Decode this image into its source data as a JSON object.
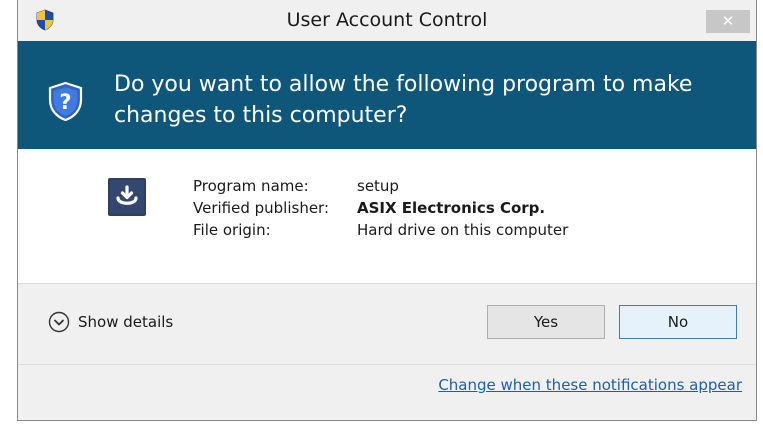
{
  "window": {
    "title": "User Account Control",
    "close_glyph": "✕"
  },
  "header": {
    "question": "Do you want to allow the following program to make changes to this computer?",
    "icon": "help-shield-icon"
  },
  "program": {
    "icon": "setup-icon",
    "fields": [
      {
        "label": "Program name:",
        "value": "setup",
        "bold": false
      },
      {
        "label": "Verified publisher:",
        "value": "ASIX Electronics Corp.",
        "bold": true
      },
      {
        "label": "File origin:",
        "value": "Hard drive on this computer",
        "bold": false
      }
    ]
  },
  "actions": {
    "show_details": "Show details",
    "yes": "Yes",
    "no": "No"
  },
  "footer": {
    "link": "Change when these notifications appear"
  },
  "colors": {
    "header_bg": "#0f577a",
    "link": "#1e5fa8"
  }
}
